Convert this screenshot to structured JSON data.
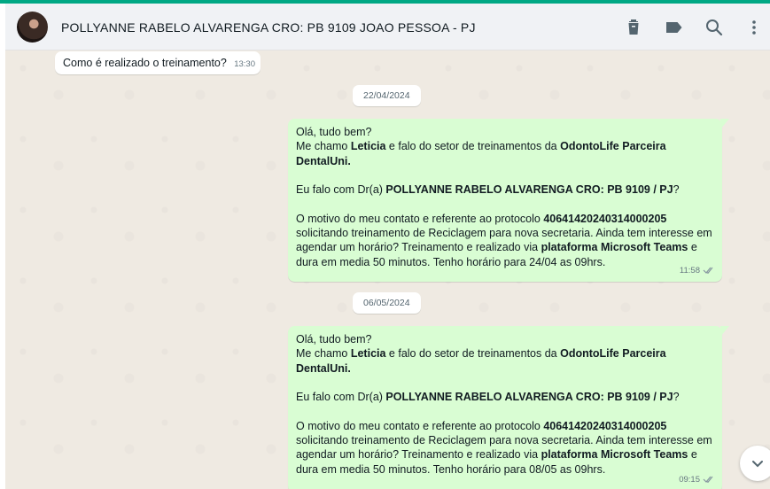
{
  "header": {
    "contact_name": "POLLYANNE RABELO ALVARENGA CRO: PB  9109 JOAO PESSOA - PJ",
    "icons": [
      "trash-icon",
      "label-icon",
      "search-icon",
      "more-vertical-icon"
    ]
  },
  "messages": {
    "first": {
      "text": "Como é realizado o treinamento?",
      "time": "13:30"
    },
    "date1": "22/04/2024",
    "msg1": {
      "l1": "Olá, tudo bem?",
      "l2_a": "Me chamo ",
      "l2_name": "Leticia",
      "l2_b": " e falo do setor de treinamentos  da ",
      "l2_company": "OdontoLife Parceira",
      "l3": "DentalUni.",
      "l4_a": " Eu falo com Dr(a) ",
      "l4_b": "POLLYANNE RABELO ALVARENGA CRO: PB 9109 / PJ",
      "l4_c": "?",
      "l5_a": "O motivo do meu contato e referente ao protocolo ",
      "l5_b": "40641420240314000205",
      "l6": "solicitando treinamento de Reciclagem para nova secretaria. Ainda tem interesse em",
      "l7_a": "agendar um horário? Treinamento e realizado via  ",
      "l7_b": "plataforma Microsoft Teams",
      "l7_c": " e",
      "l8": "dura em media 50 minutos. Tenho horário para 24/04 as 09hrs.",
      "time": "11:58"
    },
    "date2": "06/05/2024",
    "msg2": {
      "l1": "Olá, tudo bem?",
      "l2_a": "Me chamo ",
      "l2_name": "Leticia",
      "l2_b": " e falo do setor de treinamentos  da ",
      "l2_company": "OdontoLife Parceira",
      "l3": "DentalUni.",
      "l4_a": " Eu falo com Dr(a) ",
      "l4_b": "POLLYANNE RABELO ALVARENGA CRO: PB 9109 / PJ",
      "l4_c": "?",
      "l5_a": "O motivo do meu contato e referente ao protocolo ",
      "l5_b": "40641420240314000205",
      "l6": "solicitando treinamento de Reciclagem para nova secretaria. Ainda tem interesse em",
      "l7_a": "agendar um horário? Treinamento e realizado via  ",
      "l7_b": "plataforma Microsoft Teams",
      "l7_c": " e",
      "l8": "dura em media 50 minutos. Tenho horário para 08/05 as 09hrs.",
      "time": "09:15"
    }
  },
  "colors": {
    "accent": "#00a884",
    "outgoing_bubble": "#d9fdd3",
    "incoming_bubble": "#ffffff"
  }
}
